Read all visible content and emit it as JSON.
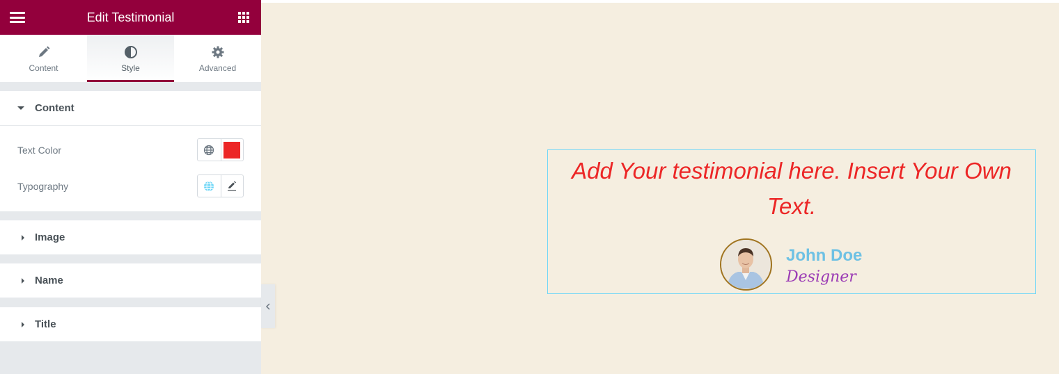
{
  "header": {
    "title": "Edit Testimonial",
    "menu_icon": "hamburger-icon",
    "apps_icon": "grid-icon"
  },
  "tabs": [
    {
      "label": "Content",
      "icon": "pencil-icon",
      "active": false
    },
    {
      "label": "Style",
      "icon": "contrast-icon",
      "active": true
    },
    {
      "label": "Advanced",
      "icon": "gear-icon",
      "active": false
    }
  ],
  "sections": {
    "content": {
      "label": "Content",
      "expanded": true,
      "controls": {
        "text_color": {
          "label": "Text Color",
          "value": "#ec2626"
        },
        "typography": {
          "label": "Typography"
        }
      }
    },
    "image": {
      "label": "Image",
      "expanded": false
    },
    "name": {
      "label": "Name",
      "expanded": false
    },
    "title": {
      "label": "Title",
      "expanded": false
    }
  },
  "preview": {
    "testimonial_text": "Add Your testimonial here. Insert Your Own Text.",
    "name": "John Doe",
    "job_title": "Designer",
    "colors": {
      "text": "#ec2626",
      "name": "#6ec1e4",
      "job": "#9b3bb5",
      "canvas_bg": "#f5eee0",
      "accent": "#93003c"
    }
  }
}
